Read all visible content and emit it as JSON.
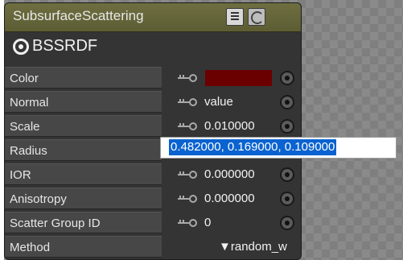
{
  "node": {
    "title": "SubsurfaceScattering",
    "subtitle": "BSSRDF",
    "colors": {
      "header": "#6e6e41",
      "body": "#343434",
      "accent": "#0a63d0",
      "swatch": "#6b0000"
    }
  },
  "properties": [
    {
      "label": "Color",
      "value": "",
      "type": "color",
      "swatch": "#6b0000"
    },
    {
      "label": "Normal",
      "value": "value",
      "type": "text"
    },
    {
      "label": "Scale",
      "value": "0.010000",
      "type": "number"
    },
    {
      "label": "Radius",
      "value": "0.482000, 0.169000, 0.109000",
      "type": "editing"
    },
    {
      "label": "IOR",
      "value": "0.000000",
      "type": "number"
    },
    {
      "label": "Anisotropy",
      "value": "0.000000",
      "type": "number"
    },
    {
      "label": "Scatter Group ID",
      "value": "0",
      "type": "number"
    },
    {
      "label": "Method",
      "value": "random_w",
      "type": "dropdown",
      "arrow": "▼"
    }
  ],
  "icons": {
    "menu": "menu-icon",
    "toggle": "toggle-icon",
    "subtitle": "shader-icon",
    "connector": "key-connector-icon",
    "socket": "socket-icon",
    "dropdown": "dropdown-arrow-icon"
  }
}
